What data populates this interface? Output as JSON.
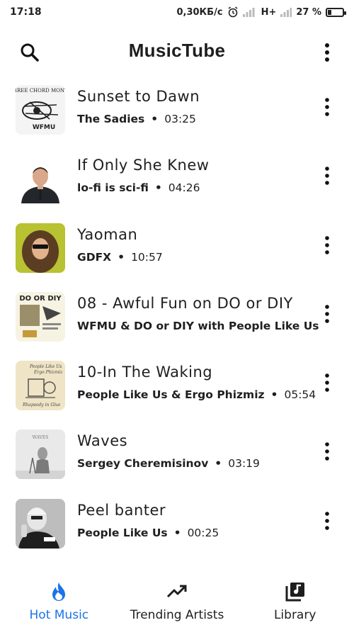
{
  "status_bar": {
    "time": "17:18",
    "network_speed": "0,30КБ/с",
    "network_type": "H+",
    "battery_percent": "27 %",
    "battery_level": 0.27
  },
  "app_bar": {
    "title": "MusicTube",
    "search_icon": "search-icon",
    "menu_icon": "more-vert-icon"
  },
  "tracks": [
    {
      "title": "Sunset to Dawn",
      "artist": "The Sadies",
      "separator": "•",
      "duration": "03:25"
    },
    {
      "title": "If Only She Knew",
      "artist": "lo-fi is sci-fi",
      "separator": "•",
      "duration": "04:26"
    },
    {
      "title": "Yaoman",
      "artist": "GDFX",
      "separator": "•",
      "duration": "10:57"
    },
    {
      "title": "08 - Awful Fun on DO or DIY",
      "artist": "WFMU & DO or DIY with People Like Us",
      "separator": "",
      "duration": ""
    },
    {
      "title": "10-In The Waking",
      "artist": "People Like Us & Ergo Phizmiz",
      "separator": "•",
      "duration": "05:54"
    },
    {
      "title": "Waves",
      "artist": "Sergey Cheremisinov",
      "separator": "•",
      "duration": "03:19"
    },
    {
      "title": "Peel banter",
      "artist": "People Like Us",
      "separator": "•",
      "duration": "00:25"
    }
  ],
  "thumbnail_text": {
    "t1_line1": "THREE CHORD MONTE",
    "t1_line2": "WFMU",
    "t4_line1": "DO OR DIY",
    "t5_line1": "People Like Us",
    "t5_line2": "Ergo Phizmiz",
    "t5_line3": "Rhapsody in Glue",
    "t6_line1": "WAVES"
  },
  "bottom_nav": {
    "items": [
      {
        "label": "Hot Music",
        "icon": "flame-icon",
        "active": true
      },
      {
        "label": "Trending Artists",
        "icon": "trending-up-icon",
        "active": false
      },
      {
        "label": "Library",
        "icon": "library-music-icon",
        "active": false
      }
    ]
  },
  "colors": {
    "accent": "#1a73e8",
    "text": "#1f1f1f",
    "background": "#ffffff"
  }
}
